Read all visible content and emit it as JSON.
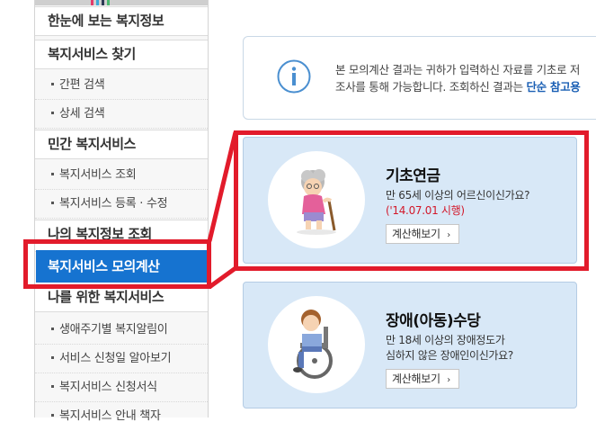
{
  "sidebar": {
    "sections": [
      {
        "label": "한눈에 보는 복지정보"
      },
      {
        "label": "복지서비스 찾기"
      },
      {
        "label": "민간 복지서비스"
      },
      {
        "label": "나의 복지정보 조회"
      },
      {
        "label": "나를 위한 복지서비스"
      }
    ],
    "items": [
      {
        "label": "간편 검색"
      },
      {
        "label": "상세 검색"
      },
      {
        "label": "복지서비스 조회"
      },
      {
        "label": "복지서비스 등록 · 수정"
      },
      {
        "label": "생애주기별 복지알림이"
      },
      {
        "label": "서비스 신청일 알아보기"
      },
      {
        "label": "복지서비스 신청서식"
      },
      {
        "label": "복지서비스 안내 책자"
      }
    ],
    "active": "복지서비스 모의계산"
  },
  "info": {
    "line1": "본 모의계산 결과는 귀하가 입력하신 자료를 기초로 저",
    "line2_prefix": "조사를 통해 가능합니다. 조회하신 결과는 ",
    "line2_highlight": "단순 참고용"
  },
  "cards": [
    {
      "title": "기초연금",
      "desc1": "만 65세 이상의 어르신이신가요?",
      "desc2": "('14.07.01 시행)",
      "button": "계산해보기"
    },
    {
      "title": "장애(아동)수당",
      "desc1": "만 18세 이상의 장애정도가",
      "desc2": "심하지 않은 장애인이신가요?",
      "button": "계산해보기"
    }
  ],
  "colors": {
    "accent": "#1673d0",
    "highlight": "#e21b2b",
    "card_bg": "#d8e8f7"
  }
}
